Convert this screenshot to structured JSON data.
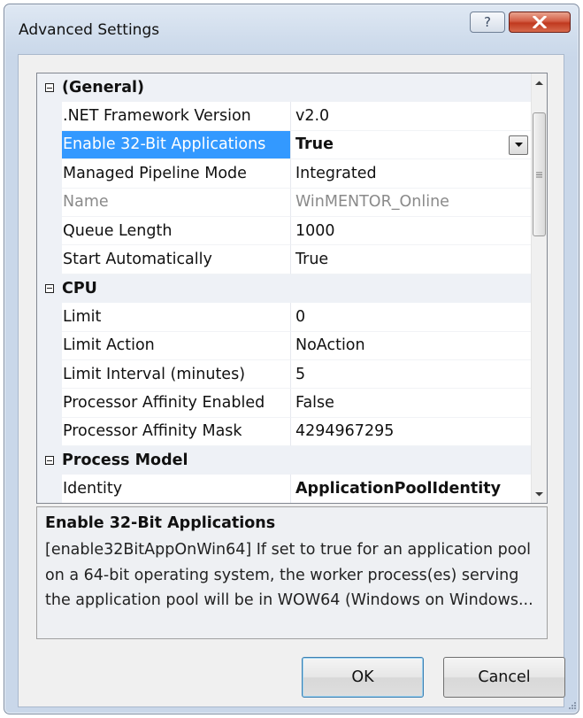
{
  "window": {
    "title": "Advanced Settings",
    "help_label": "?",
    "close_label": "X"
  },
  "property_grid": {
    "rows": [
      {
        "kind": "category",
        "label": "(General)"
      },
      {
        "kind": "property",
        "name": ".NET Framework Version",
        "value": "v2.0"
      },
      {
        "kind": "property",
        "name": "Enable 32-Bit Applications",
        "value": "True",
        "selected": true,
        "bold": true,
        "dropdown": true
      },
      {
        "kind": "property",
        "name": "Managed Pipeline Mode",
        "value": "Integrated"
      },
      {
        "kind": "property",
        "name": "Name",
        "value": "WinMENTOR_Online",
        "disabled": true
      },
      {
        "kind": "property",
        "name": "Queue Length",
        "value": "1000"
      },
      {
        "kind": "property",
        "name": "Start Automatically",
        "value": "True"
      },
      {
        "kind": "category",
        "label": "CPU"
      },
      {
        "kind": "property",
        "name": "Limit",
        "value": "0"
      },
      {
        "kind": "property",
        "name": "Limit Action",
        "value": "NoAction"
      },
      {
        "kind": "property",
        "name": "Limit Interval (minutes)",
        "value": "5"
      },
      {
        "kind": "property",
        "name": "Processor Affinity Enabled",
        "value": "False"
      },
      {
        "kind": "property",
        "name": "Processor Affinity Mask",
        "value": "4294967295"
      },
      {
        "kind": "category",
        "label": "Process Model"
      },
      {
        "kind": "property",
        "name": "Identity",
        "value": "ApplicationPoolIdentity",
        "bold": true
      }
    ]
  },
  "description": {
    "title": "Enable 32-Bit Applications",
    "text": "[enable32BitAppOnWin64] If set to true for an application pool on a 64-bit operating system, the worker process(es) serving the application pool will be in WOW64 (Windows on Windows..."
  },
  "buttons": {
    "ok_label": "OK",
    "cancel_label": "Cancel"
  },
  "colors": {
    "selection": "#3399ff",
    "category_background": "#eef1f6",
    "close_button": "#c0391f"
  },
  "icons": {
    "help": "question-icon",
    "close": "close-icon",
    "collapse": "minus-box-icon",
    "dropdown": "chevron-down-icon",
    "scroll_up": "arrow-up-icon",
    "scroll_down": "arrow-down-icon"
  }
}
